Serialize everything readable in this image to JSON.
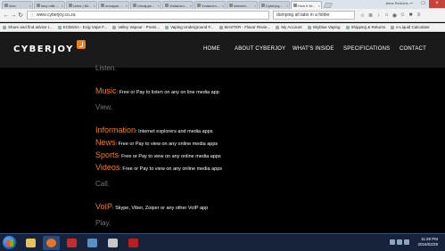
{
  "browser": {
    "tabs": [
      {
        "label": "Inbo"
      },
      {
        "label": "Iazy milk ..."
      },
      {
        "label": "Links | Mi..."
      },
      {
        "label": "uncappe..."
      },
      {
        "label": "Uncappe..."
      },
      {
        "label": "Vodacom..."
      },
      {
        "label": "Vodacom..."
      },
      {
        "label": "Internet..."
      },
      {
        "label": "Cyberjoy..."
      },
      {
        "label": "How It W..."
      }
    ],
    "profile_name": "Alma ReAdvis...",
    "url": "www.cyberjoy.co.za",
    "search_text": "dumping all tabs in a folder",
    "bookmarks": [
      "Share and find advice r...",
      "ECBSSA - Ecig Vape F...",
      "Valley Vapour - Premi...",
      "Vaping Underground F...",
      "MASTER - Flavor Revie...",
      "My Account",
      "Skyblue Vaping",
      "Shipping & Returns",
      "e-Liquid Calculator"
    ]
  },
  "site": {
    "logo": "CYBERJOY",
    "nav": [
      "HOME",
      "ABOUT CYBERJOY",
      "WHAT'S INSIDE",
      "SPECIFICATIONS",
      "CONTACT"
    ]
  },
  "content": {
    "listen_heading": "Listen.",
    "music": {
      "label": "Music",
      "desc": ": Free or Pay to listen on any on line media app"
    },
    "view_heading": "View.",
    "information": {
      "label": "Information",
      "desc": ": Internet explorers and media apps"
    },
    "news": {
      "label": "News",
      "desc": ": Free or Pay to view on any online media apps"
    },
    "sports": {
      "label": "Sports",
      "desc": ": Free or Pay to view on any online media apps"
    },
    "videos": {
      "label": "Videos",
      "desc": ": Free or Pay to view on any online media apps"
    },
    "call_heading": "Call.",
    "voip": {
      "label": "VoIP",
      "desc": ": Skype, Viber, Zoiper or any other VoIP app"
    },
    "play_heading": "Play."
  },
  "taskbar": {
    "time": "11:28 PM",
    "date": "2016/02/29"
  }
}
